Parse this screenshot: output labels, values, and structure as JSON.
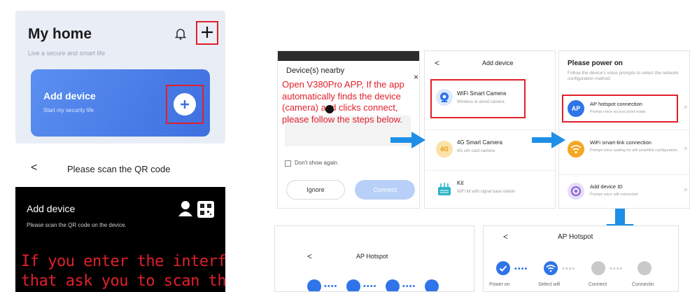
{
  "home": {
    "title": "My home",
    "subtitle": "Live a secure and smart life",
    "card_title": "Add device",
    "card_subtitle": "Start my security life",
    "bell_icon": "bell-icon",
    "plus_icon": "plus-icon"
  },
  "qr": {
    "header_title": "Please scan the QR code",
    "back": "<",
    "panel_title": "Add device",
    "panel_subtitle": "Please scan the QR code on the device.",
    "note_line1": "If you enter the interface",
    "note_line2": "that ask you to scan the"
  },
  "nearby": {
    "title": "Device(s) nearby",
    "close": "×",
    "note": "Open V380Pro APP, If the app automatically finds the device (camera) and clicks connect, please follow the steps below.",
    "dont_show": "Don't show again",
    "ignore": "Ignore",
    "connect": "Connect"
  },
  "add_device": {
    "back": "<",
    "title": "Add device",
    "items": [
      {
        "label": "WiFi Smart Camera",
        "sub": "Wireless or wired camera"
      },
      {
        "label": "4G Smart Camera",
        "sub": "4G sim card camera"
      },
      {
        "label": "Kit",
        "sub": "WiFi kit with signal base station"
      }
    ],
    "badge_4g": "4G"
  },
  "power": {
    "title": "Please power on",
    "desc": "Follow the device's voice prompts to select the network configuration method",
    "items": [
      {
        "label": "AP hotspot connection",
        "sub": "Prompt voice access point ready",
        "badge": "AP"
      },
      {
        "label": "WiFi smart-link connection",
        "sub": "Prompt voice waiting for wifi smartlink configuration"
      },
      {
        "label": "Add device ID",
        "sub": "Prompt voice wifi connected"
      }
    ],
    "chevron": ">"
  },
  "ap1": {
    "back": "<",
    "title": "AP Hotspot"
  },
  "ap2": {
    "back": "<",
    "title": "AP Hotspot",
    "steps": [
      "Power on",
      "Select wifi",
      "Connect",
      "Connectin"
    ]
  },
  "colors": {
    "accent": "#2f74e8",
    "annotation": "#e0202a",
    "arrow": "#1e8fe6"
  }
}
